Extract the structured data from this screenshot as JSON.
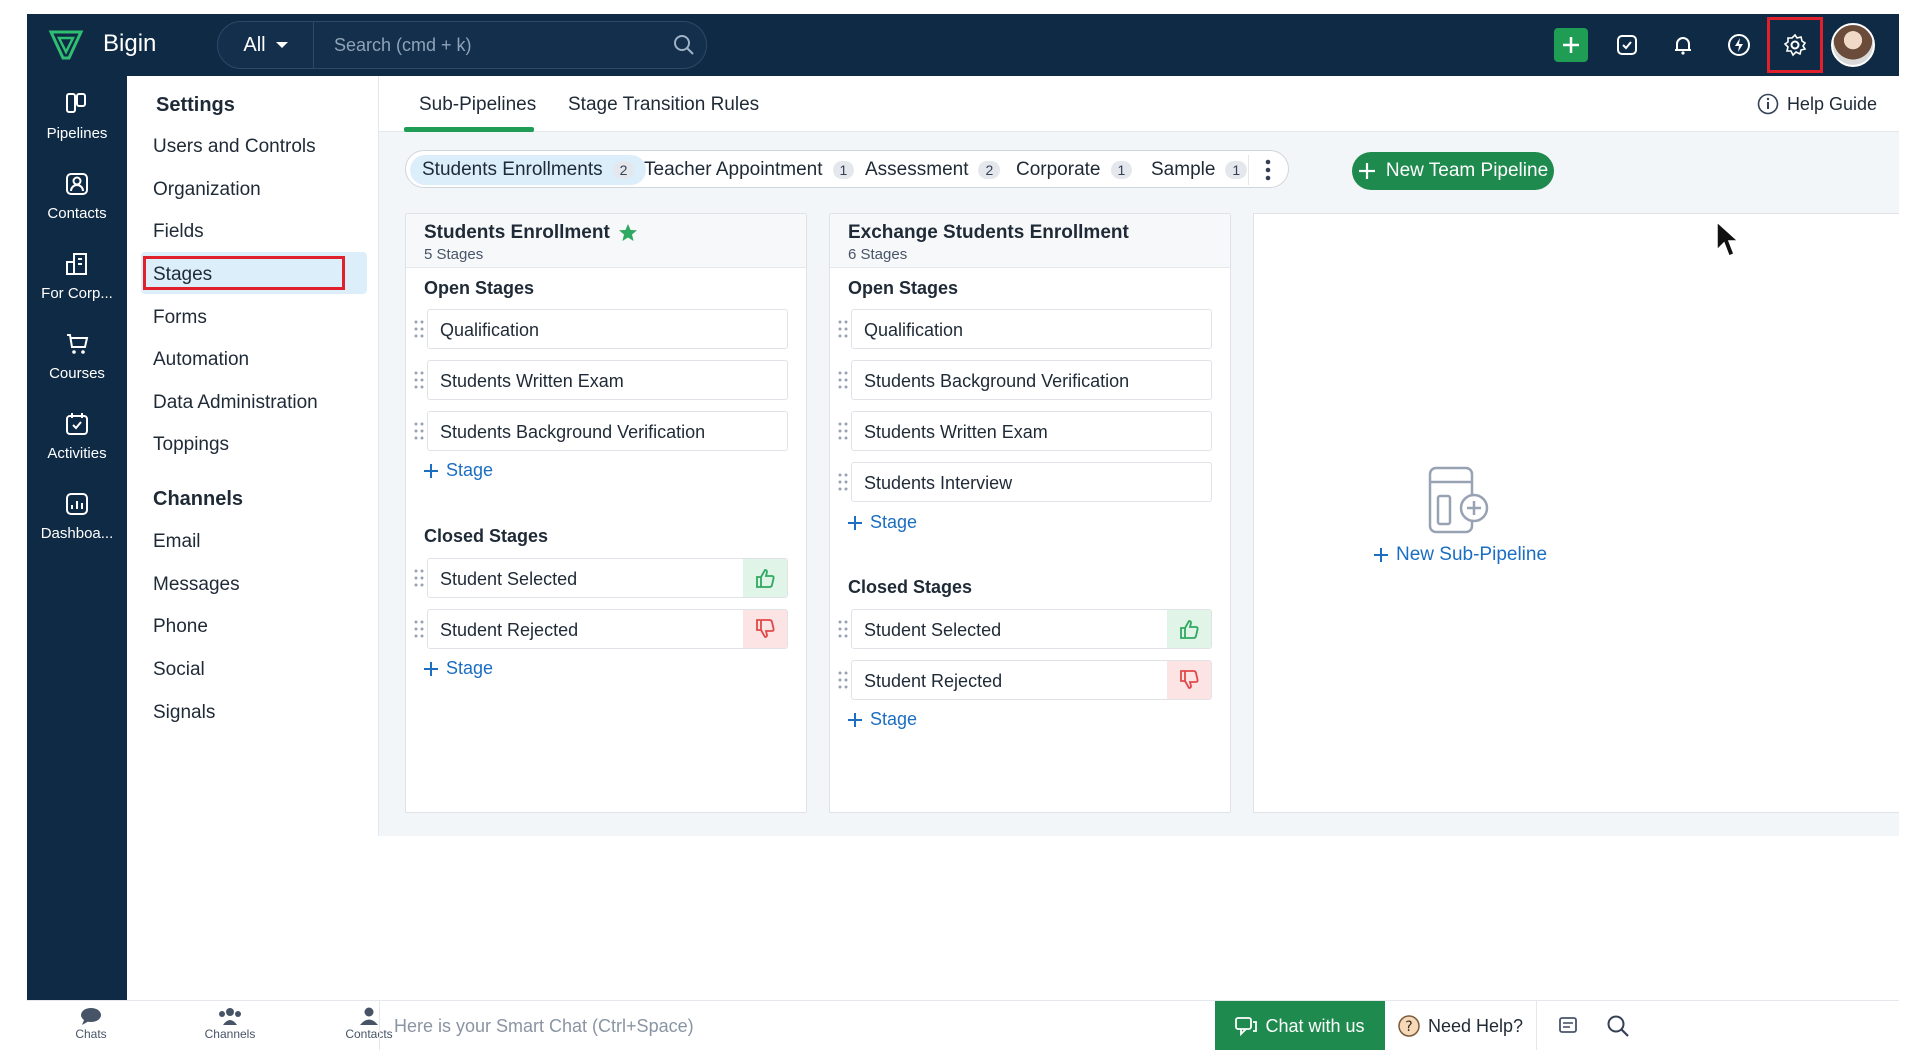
{
  "topbar": {
    "brand": "Bigin",
    "search_scope": "All",
    "search_placeholder": "Search (cmd + k)"
  },
  "rail": {
    "items": [
      {
        "label": "Pipelines",
        "icon": "pipelines-icon"
      },
      {
        "label": "Contacts",
        "icon": "contacts-icon"
      },
      {
        "label": "For Corp...",
        "icon": "company-icon"
      },
      {
        "label": "Courses",
        "icon": "cart-icon"
      },
      {
        "label": "Activities",
        "icon": "activities-icon"
      },
      {
        "label": "Dashboa...",
        "icon": "dashboard-icon"
      }
    ]
  },
  "settings": {
    "title": "Settings",
    "items": [
      "Users and Controls",
      "Organization",
      "Fields",
      "Stages",
      "Forms",
      "Automation",
      "Data Administration",
      "Toppings"
    ],
    "active": "Stages",
    "channels_title": "Channels",
    "channels": [
      "Email",
      "Messages",
      "Phone",
      "Social",
      "Signals"
    ]
  },
  "main": {
    "tabs": [
      "Sub-Pipelines",
      "Stage Transition Rules"
    ],
    "active_tab": "Sub-Pipelines",
    "help_label": "Help Guide",
    "pipeline_tabs": [
      {
        "label": "Students Enrollments",
        "count": "2"
      },
      {
        "label": "Teacher Appointment",
        "count": "1"
      },
      {
        "label": "Assessment",
        "count": "2"
      },
      {
        "label": "Corporate",
        "count": "1"
      },
      {
        "label": "Sample",
        "count": "1"
      }
    ],
    "new_team_pipeline": "New Team Pipeline",
    "cards": [
      {
        "title": "Students Enrollment",
        "subtitle": "5 Stages",
        "open_title": "Open Stages",
        "open_stages": [
          "Qualification",
          "Students Written Exam",
          "Students Background Verification"
        ],
        "add_stage": "Stage",
        "closed_title": "Closed Stages",
        "closed_stages": [
          "Student Selected",
          "Student Rejected"
        ]
      },
      {
        "title": "Exchange Students Enrollment",
        "subtitle": "6 Stages",
        "open_title": "Open Stages",
        "open_stages": [
          "Qualification",
          "Students Background Verification",
          "Students Written Exam",
          "Students Interview"
        ],
        "add_stage": "Stage",
        "closed_title": "Closed Stages",
        "closed_stages": [
          "Student Selected",
          "Student Rejected"
        ]
      }
    ],
    "new_sub_pipeline": "New Sub-Pipeline"
  },
  "bottombar": {
    "tabs": [
      "Chats",
      "Channels",
      "Contacts"
    ],
    "smart_chat_placeholder": "Here is your Smart Chat (Ctrl+Space)",
    "chat_with_us": "Chat with us",
    "need_help": "Need Help?"
  },
  "colors": {
    "nav_bg": "#0f2a44",
    "accent_green": "#1e8a4e",
    "link_blue": "#1b6ec2",
    "highlight_red": "#e0202b",
    "active_bg": "#dceefa"
  }
}
